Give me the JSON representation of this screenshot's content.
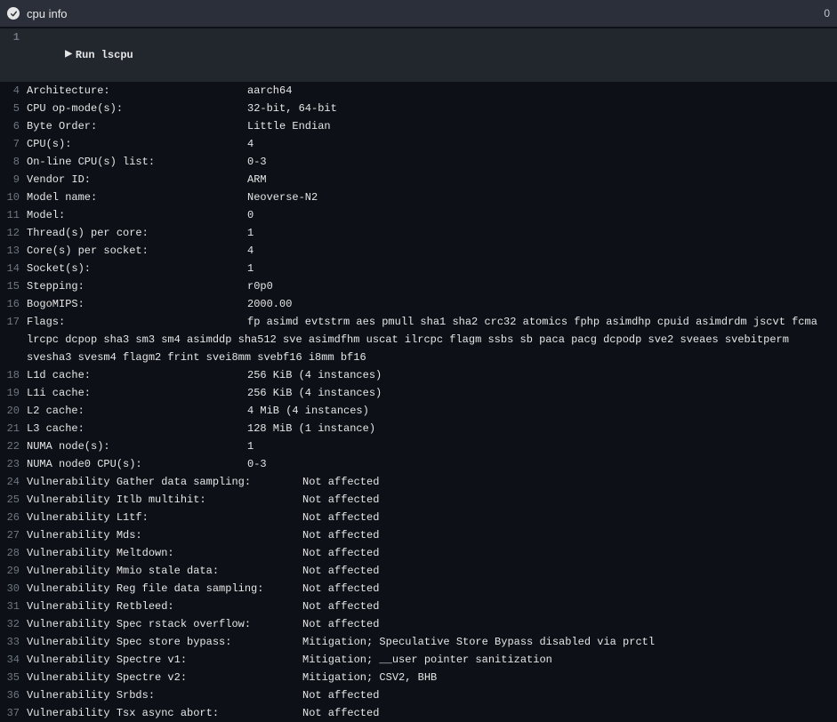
{
  "header": {
    "title": "cpu info",
    "duration": "0"
  },
  "run": {
    "lineno": "1",
    "caret": "▶",
    "label": "Run lscpu"
  },
  "rows": [
    {
      "n": "4",
      "key": "Architecture:",
      "val": "aarch64",
      "kw": 248
    },
    {
      "n": "5",
      "key": "CPU op-mode(s):",
      "val": "32-bit, 64-bit",
      "kw": 248
    },
    {
      "n": "6",
      "key": "Byte Order:",
      "val": "Little Endian",
      "kw": 248
    },
    {
      "n": "7",
      "key": "CPU(s):",
      "val": "4",
      "kw": 248
    },
    {
      "n": "8",
      "key": "On-line CPU(s) list:",
      "val": "0-3",
      "kw": 248
    },
    {
      "n": "9",
      "key": "Vendor ID:",
      "val": "ARM",
      "kw": 248
    },
    {
      "n": "10",
      "key": "Model name:",
      "val": "Neoverse-N2",
      "kw": 248
    },
    {
      "n": "11",
      "key": "Model:",
      "val": "0",
      "kw": 248
    },
    {
      "n": "12",
      "key": "Thread(s) per core:",
      "val": "1",
      "kw": 248
    },
    {
      "n": "13",
      "key": "Core(s) per socket:",
      "val": "4",
      "kw": 248
    },
    {
      "n": "14",
      "key": "Socket(s):",
      "val": "1",
      "kw": 248
    },
    {
      "n": "15",
      "key": "Stepping:",
      "val": "r0p0",
      "kw": 248
    },
    {
      "n": "16",
      "key": "BogoMIPS:",
      "val": "2000.00",
      "kw": 248
    },
    {
      "n": "17",
      "key": "Flags:",
      "val": "fp asimd evtstrm aes pmull sha1 sha2 crc32 atomics fphp asimdhp cpuid asimdrdm jscvt fcma lrcpc dcpop sha3 sm3 sm4 asimddp sha512 sve asimdfhm uscat ilrcpc flagm ssbs sb paca pacg dcpodp sve2 sveaes svebitperm svesha3 svesm4 flagm2 frint svei8mm svebf16 i8mm bf16",
      "kw": 248
    },
    {
      "n": "18",
      "key": "L1d cache:",
      "val": "256 KiB (4 instances)",
      "kw": 248
    },
    {
      "n": "19",
      "key": "L1i cache:",
      "val": "256 KiB (4 instances)",
      "kw": 248
    },
    {
      "n": "20",
      "key": "L2 cache:",
      "val": "4 MiB (4 instances)",
      "kw": 248
    },
    {
      "n": "21",
      "key": "L3 cache:",
      "val": "128 MiB (1 instance)",
      "kw": 248
    },
    {
      "n": "22",
      "key": "NUMA node(s):",
      "val": "1",
      "kw": 248
    },
    {
      "n": "23",
      "key": "NUMA node0 CPU(s):",
      "val": "0-3",
      "kw": 248
    },
    {
      "n": "24",
      "key": "Vulnerability Gather data sampling:",
      "val": "Not affected",
      "kw": 310
    },
    {
      "n": "25",
      "key": "Vulnerability Itlb multihit:",
      "val": "Not affected",
      "kw": 310
    },
    {
      "n": "26",
      "key": "Vulnerability L1tf:",
      "val": "Not affected",
      "kw": 310
    },
    {
      "n": "27",
      "key": "Vulnerability Mds:",
      "val": "Not affected",
      "kw": 310
    },
    {
      "n": "28",
      "key": "Vulnerability Meltdown:",
      "val": "Not affected",
      "kw": 310
    },
    {
      "n": "29",
      "key": "Vulnerability Mmio stale data:",
      "val": "Not affected",
      "kw": 310
    },
    {
      "n": "30",
      "key": "Vulnerability Reg file data sampling:",
      "val": "Not affected",
      "kw": 310
    },
    {
      "n": "31",
      "key": "Vulnerability Retbleed:",
      "val": "Not affected",
      "kw": 310
    },
    {
      "n": "32",
      "key": "Vulnerability Spec rstack overflow:",
      "val": "Not affected",
      "kw": 310
    },
    {
      "n": "33",
      "key": "Vulnerability Spec store bypass:",
      "val": "Mitigation; Speculative Store Bypass disabled via prctl",
      "kw": 310
    },
    {
      "n": "34",
      "key": "Vulnerability Spectre v1:",
      "val": "Mitigation; __user pointer sanitization",
      "kw": 310
    },
    {
      "n": "35",
      "key": "Vulnerability Spectre v2:",
      "val": "Mitigation; CSV2, BHB",
      "kw": 310
    },
    {
      "n": "36",
      "key": "Vulnerability Srbds:",
      "val": "Not affected",
      "kw": 310
    },
    {
      "n": "37",
      "key": "Vulnerability Tsx async abort:",
      "val": "Not affected",
      "kw": 310
    }
  ]
}
